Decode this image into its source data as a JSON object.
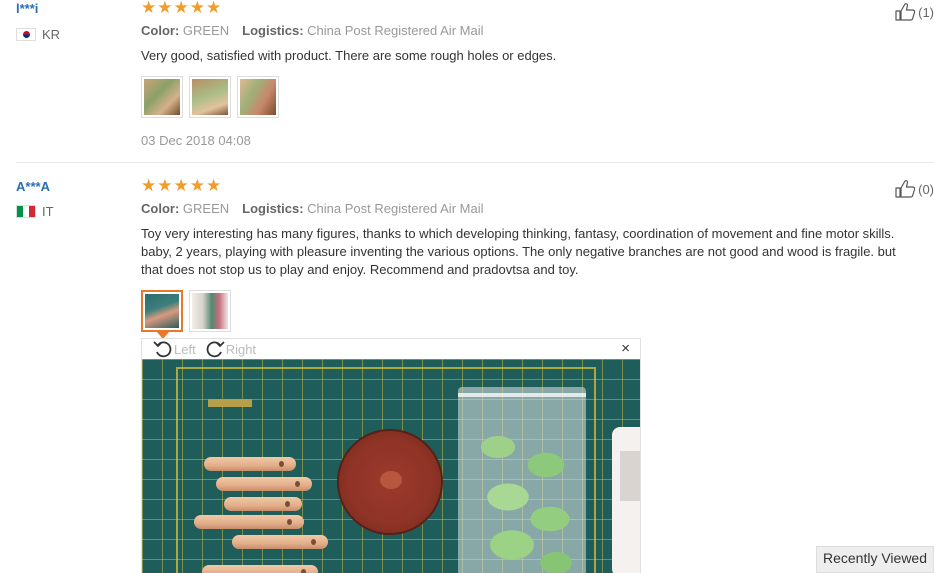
{
  "reviews": [
    {
      "user": "l***i",
      "country": "KR",
      "stars": 5,
      "color_label": "Color:",
      "color_value": "GREEN",
      "logistics_label": "Logistics:",
      "logistics_value": "China Post Registered Air Mail",
      "text": "Very good, satisfied with product. There are some rough holes or edges.",
      "photo_count": 3,
      "date": "03 Dec 2018 04:08",
      "likes": "(1)"
    },
    {
      "user": "A***A",
      "country": "IT",
      "stars": 5,
      "color_label": "Color:",
      "color_value": "GREEN",
      "logistics_label": "Logistics:",
      "logistics_value": "China Post Registered Air Mail",
      "text": "Toy very interesting has many figures, thanks to which developing thinking, fantasy, coordination of movement and fine motor skills. baby, 2 years, playing with pleasure inventing the various options. The only negative branches are not good and wood is fragile. but that does not stop us to play and enjoy. Recommend and pradovtsa and toy.",
      "photo_count": 2,
      "likes": "(0)"
    }
  ],
  "viewer": {
    "rotate_left": "Left",
    "rotate_right": "Right",
    "close": "×"
  },
  "icons": {
    "star": "★",
    "accent": "#f29c2a",
    "link": "#2a6db5"
  },
  "recently_viewed": "Recently Viewed"
}
